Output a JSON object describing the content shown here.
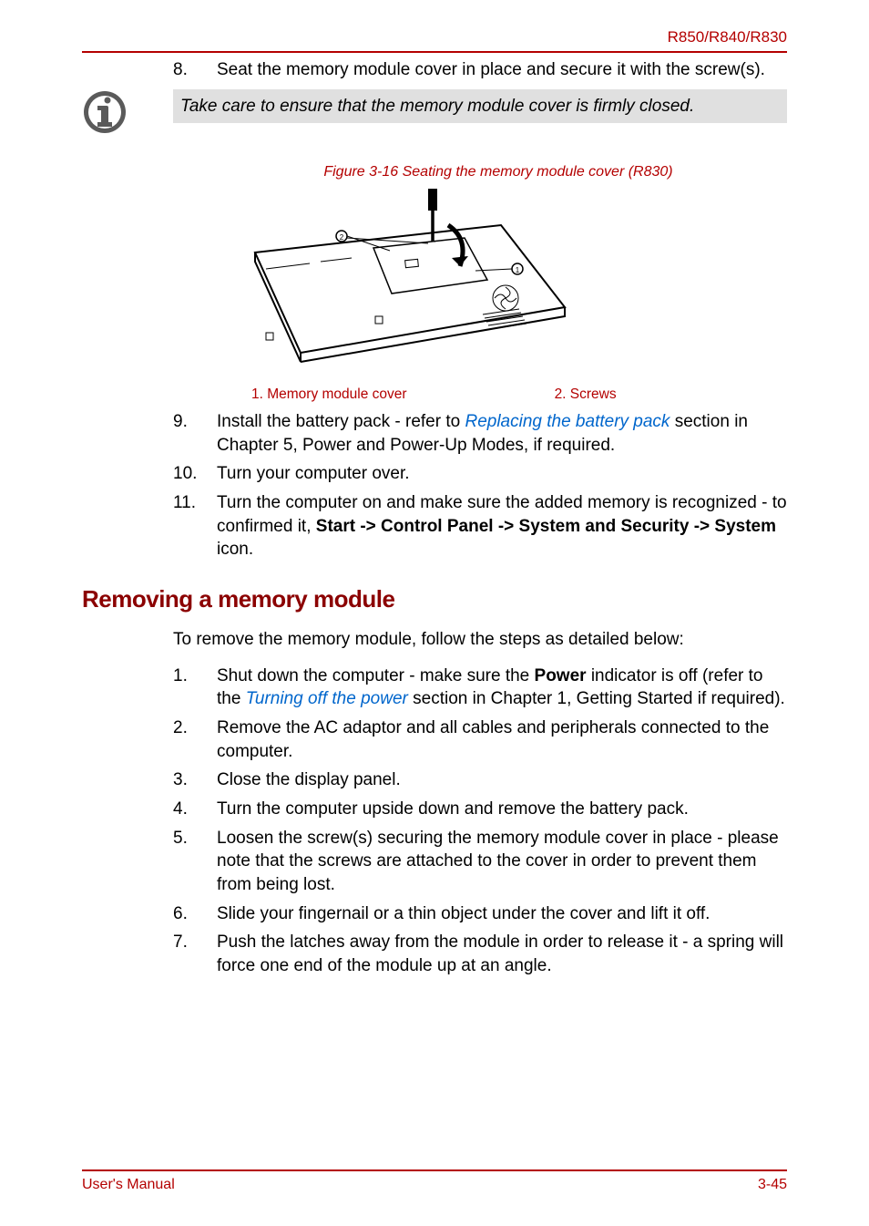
{
  "header": {
    "model": "R850/R840/R830"
  },
  "step8": {
    "num": "8.",
    "text_a": "Seat the memory module cover in place and secure it with the screw(s)."
  },
  "note": {
    "text": "Take care to ensure that the memory module cover is firmly closed."
  },
  "figure": {
    "caption": "Figure 3-16 Seating the memory module cover (R830)",
    "legend1": "1. Memory module cover",
    "legend2": "2. Screws"
  },
  "step9": {
    "num": "9.",
    "text_a": "Install the battery pack - refer to ",
    "link": "Replacing the battery pack",
    "text_b": " section in Chapter 5, Power and Power-Up Modes, if required."
  },
  "step10": {
    "num": "10.",
    "text": "Turn your computer over."
  },
  "step11": {
    "num": "11.",
    "text_a": "Turn the computer on and make sure the added memory is recognized - to confirmed it, ",
    "bold": "Start -> Control Panel -> System and Security -> System",
    "text_b": " icon."
  },
  "section": {
    "heading": "Removing a memory module",
    "intro": "To remove the memory module, follow the steps as detailed below:"
  },
  "r1": {
    "num": "1.",
    "text_a": "Shut down the computer - make sure the ",
    "bold": "Power",
    "text_b": " indicator is off (refer to the ",
    "link": "Turning off the power",
    "text_c": " section in Chapter 1, Getting Started if required)."
  },
  "r2": {
    "num": "2.",
    "text": "Remove the AC adaptor and all cables and peripherals connected to the computer."
  },
  "r3": {
    "num": "3.",
    "text": "Close the display panel."
  },
  "r4": {
    "num": "4.",
    "text": "Turn the computer upside down and remove the battery pack."
  },
  "r5": {
    "num": "5.",
    "text": "Loosen the screw(s) securing the memory module cover in place - please note that the screws are attached to the cover in order to prevent them from being lost."
  },
  "r6": {
    "num": "6.",
    "text": "Slide your fingernail or a thin object under the cover and lift it off."
  },
  "r7": {
    "num": "7.",
    "text": "Push the latches away from the module in order to release it - a spring will force one end of the module up at an angle."
  },
  "footer": {
    "left": "User's Manual",
    "right": "3-45"
  }
}
